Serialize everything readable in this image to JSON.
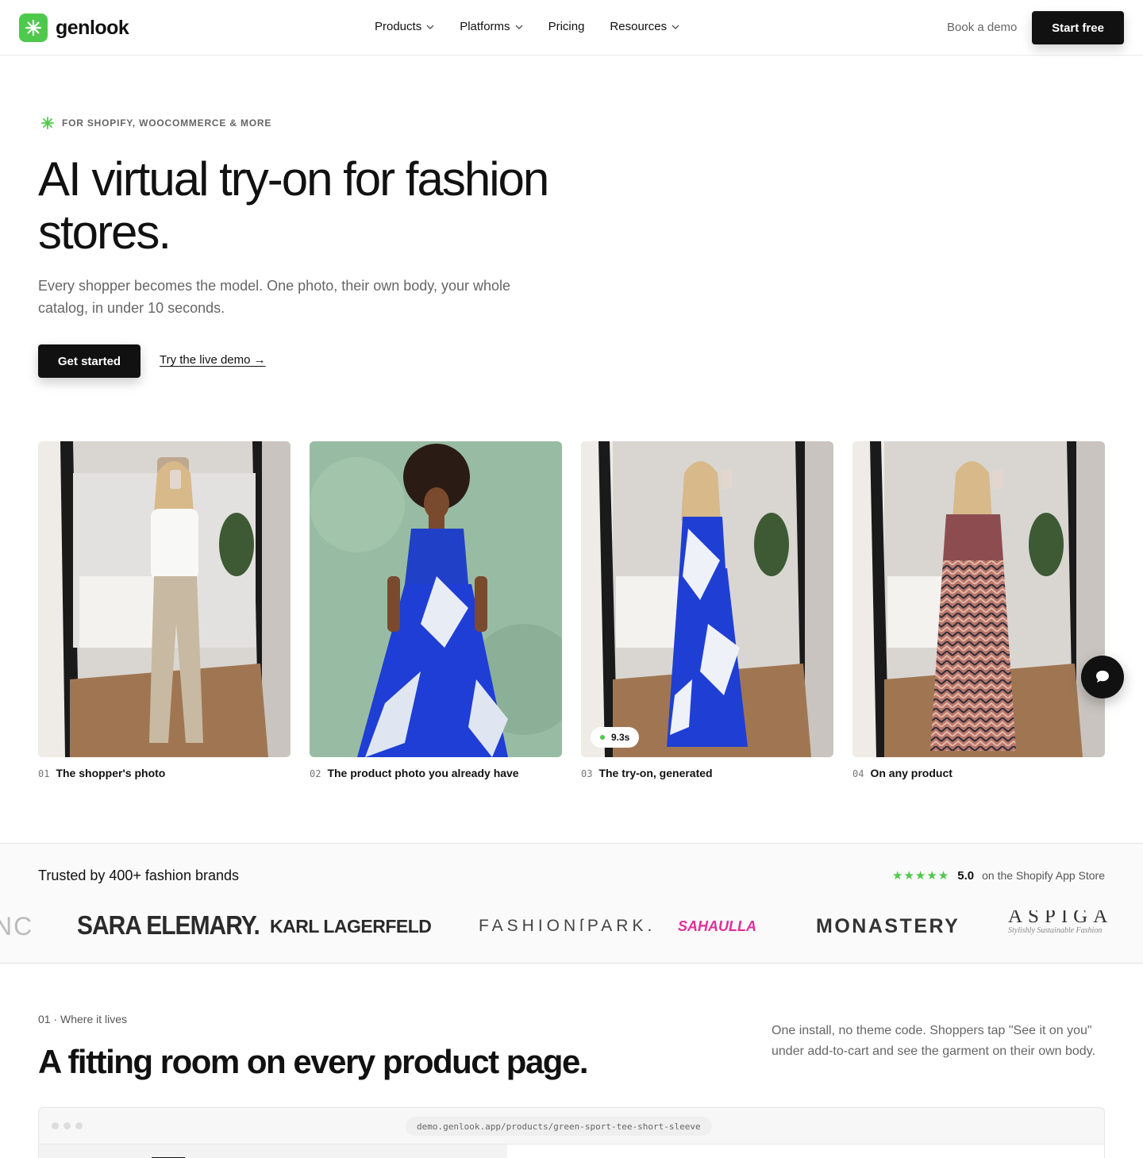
{
  "nav": {
    "brand": "genlook",
    "links": [
      {
        "label": "Products",
        "dropdown": true
      },
      {
        "label": "Platforms",
        "dropdown": true
      },
      {
        "label": "Pricing",
        "dropdown": false
      },
      {
        "label": "Resources",
        "dropdown": true
      }
    ],
    "book_demo": "Book a demo",
    "start_free": "Start free"
  },
  "hero": {
    "eyebrow": "FOR SHOPIFY, WOOCOMMERCE & MORE",
    "title": "AI virtual try-on for fashion stores.",
    "subtitle": "Every shopper becomes the model. One photo, their own body, your whole catalog, in under 10 seconds.",
    "cta_primary": "Get started",
    "cta_secondary": "Try the live demo →"
  },
  "cards": [
    {
      "num": "01",
      "label": "The shopper's photo"
    },
    {
      "num": "02",
      "label": "The product photo you already have"
    },
    {
      "num": "03",
      "label": "The try-on, generated",
      "badge": "9.3s"
    },
    {
      "num": "04",
      "label": "On any product"
    }
  ],
  "trust": {
    "title": "Trusted by 400+ fashion brands",
    "stars": "★★★★★",
    "score": "5.0",
    "store": "on the Shopify App Store",
    "brands": [
      "NC",
      "SARA ELEMARY.",
      "KARL LAGERFELD",
      "FASHIONſPARK.",
      "SAHAULLA",
      "MONASTERY",
      "ASPIGA",
      "Stylishly Sustainable Fashion"
    ]
  },
  "section1": {
    "eyebrow": "01 · Where it lives",
    "title": "A fitting room on every product page.",
    "description": "One install, no theme code. Shoppers tap \"See it on you\" under add-to-cart and see the garment on their own body.",
    "browser_url": "demo.genlook.app/products/green-sport-tee-short-sleeve"
  },
  "colors": {
    "accent": "#4ec94b",
    "dark": "#111111",
    "muted": "#666666"
  }
}
